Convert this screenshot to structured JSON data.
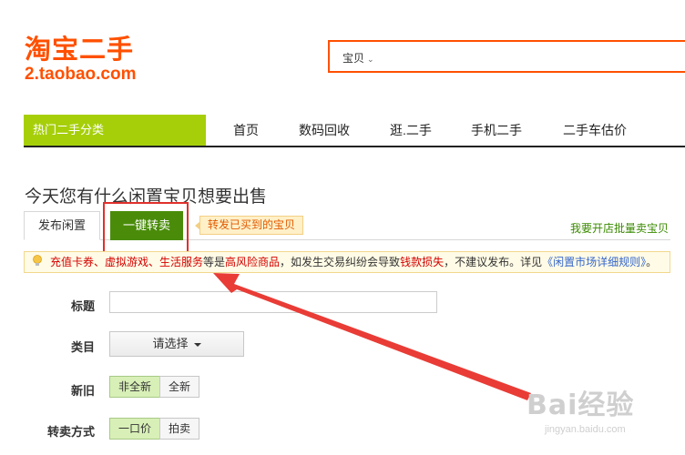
{
  "logo": {
    "cn": "淘宝二手",
    "en": "2.taobao.com"
  },
  "search": {
    "type_label": "宝贝",
    "type_caret": "⌄"
  },
  "nav": {
    "category_label": "热门二手分类",
    "items": [
      "首页",
      "数码回收",
      "逛.二手",
      "手机二手",
      "二手车估价"
    ]
  },
  "page_title": "今天您有什么闲置宝贝想要出售",
  "tabs": [
    {
      "label": "发布闲置"
    },
    {
      "label": "一键转卖"
    }
  ],
  "tip_bubble": "转发已买到的宝贝",
  "shop_link": "我要开店批量卖宝贝",
  "warning": {
    "part1": "充值卡券、虚拟游戏、生活服务",
    "part2": "等是",
    "part3": "高风险商品",
    "part4": "，如发生交易纠纷会导致",
    "part5": "钱款损失",
    "part6": "，不建议发布。详见",
    "link": "《闲置市场详细规则》",
    "part7": "。"
  },
  "form": {
    "title_label": "标题",
    "title_value": "",
    "category_label": "类目",
    "category_select": "请选择",
    "condition_label": "新旧",
    "condition_options": [
      "非全新",
      "全新"
    ],
    "condition_selected": "非全新",
    "sale_label": "转卖方式",
    "sale_options": [
      "一口价",
      "拍卖"
    ],
    "sale_selected": "一口价"
  },
  "watermark": {
    "big": "Bai经验",
    "small": "jingyan.baidu.com"
  },
  "colors": {
    "brand_orange": "#ff5000",
    "nav_green": "#a6cf0a",
    "tab_green": "#4a8c0a",
    "annotation_red": "#e0302c",
    "warning_red": "#d40000",
    "link_blue": "#3366cc"
  },
  "icons": [
    "chevron-down-icon",
    "lightbulb-icon",
    "annotation-arrow-icon"
  ]
}
